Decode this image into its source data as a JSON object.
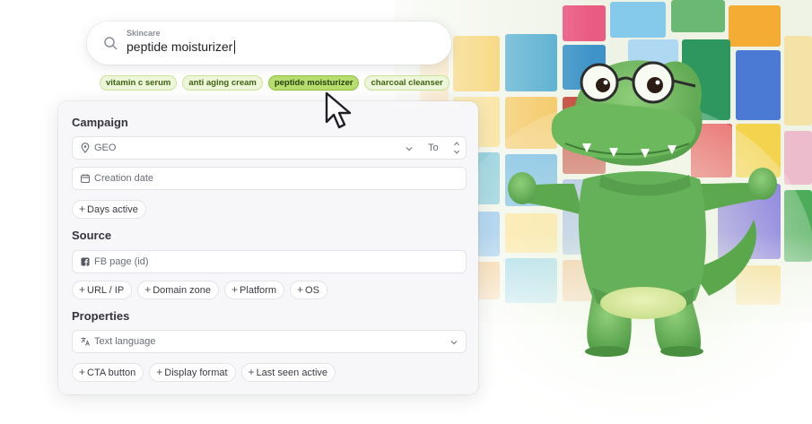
{
  "search": {
    "category": "Skincare",
    "query": "peptide moisturizer",
    "icon": "search-icon"
  },
  "suggestions": [
    {
      "label": "vitamin c serum",
      "active": false
    },
    {
      "label": "anti aging cream",
      "active": false
    },
    {
      "label": "peptide moisturizer",
      "active": true
    },
    {
      "label": "charcoal cleanser",
      "active": false
    }
  ],
  "campaign": {
    "title": "Campaign",
    "geo_placeholder": "GEO",
    "to_label": "To",
    "creation_date_placeholder": "Creation date",
    "add_buttons": [
      "Days active"
    ]
  },
  "source": {
    "title": "Source",
    "fb_page_placeholder": "FB page (id)",
    "add_buttons": [
      "URL / IP",
      "Domain zone",
      "Platform",
      "OS"
    ]
  },
  "properties": {
    "title": "Properties",
    "text_language_placeholder": "Text language",
    "add_buttons": [
      "CTA button",
      "Display format",
      "Last seen active"
    ]
  },
  "colors": {
    "chip_bg": "#edf6d9",
    "chip_active_bg": "#b6dd6e",
    "chip_text": "#3f6313",
    "mascot_green": "#67b45a",
    "panel_bg": "#f7f7f9"
  }
}
